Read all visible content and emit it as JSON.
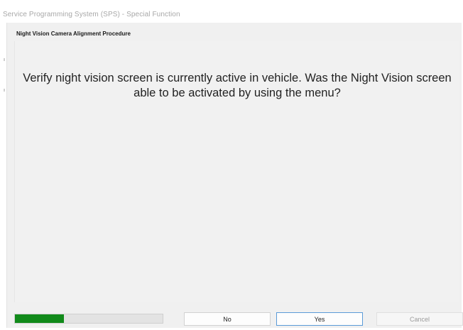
{
  "window": {
    "title": "Service Programming System (SPS) - Special Function"
  },
  "procedure": {
    "title": "Night Vision Camera Alignment Procedure"
  },
  "message": {
    "text": "Verify night vision screen is currently active in vehicle. Was the Night Vision screen able to be activated by using the menu?"
  },
  "progress": {
    "fraction": 0.33,
    "color": "#118a1a"
  },
  "buttons": {
    "no_label": "No",
    "yes_label": "Yes",
    "cancel_label": "Cancel"
  },
  "colors": {
    "progress_fill": "#118a1a",
    "focus_border": "#5a9bd8",
    "panel_background": "#f0f0f0"
  }
}
